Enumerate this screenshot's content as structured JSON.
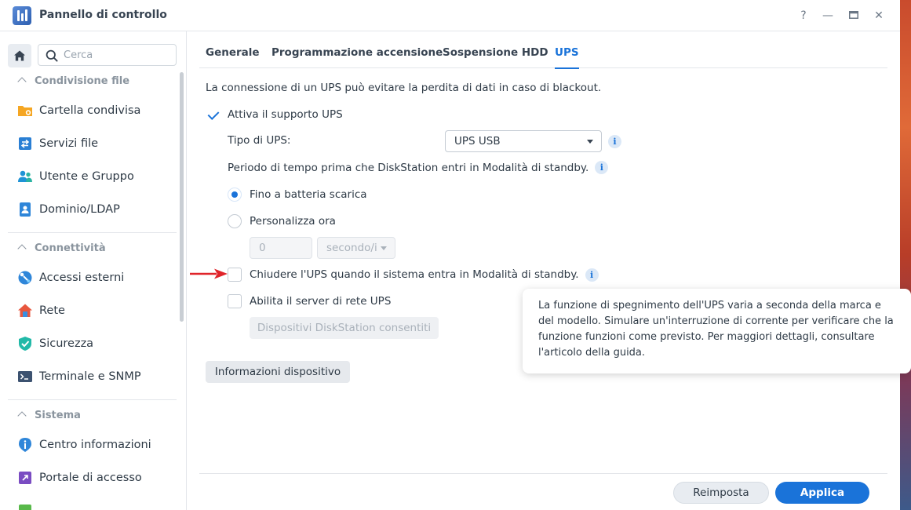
{
  "window": {
    "title": "Pannello di controllo",
    "controls": {
      "help": "?",
      "minimize": "—",
      "maximize": "▭",
      "close": "✕"
    }
  },
  "sidebar": {
    "search_placeholder": "Cerca",
    "sections": [
      {
        "title": "Condivisione file",
        "items": [
          {
            "label": "Cartella condivisa",
            "icon": "folder-share-icon"
          },
          {
            "label": "Servizi file",
            "icon": "file-services-icon"
          },
          {
            "label": "Utente e Gruppo",
            "icon": "users-icon"
          },
          {
            "label": "Dominio/LDAP",
            "icon": "domain-icon"
          }
        ]
      },
      {
        "title": "Connettività",
        "items": [
          {
            "label": "Accessi esterni",
            "icon": "external-access-icon"
          },
          {
            "label": "Rete",
            "icon": "network-house-icon"
          },
          {
            "label": "Sicurezza",
            "icon": "security-shield-icon"
          },
          {
            "label": "Terminale e SNMP",
            "icon": "terminal-icon"
          }
        ]
      },
      {
        "title": "Sistema",
        "items": [
          {
            "label": "Centro informazioni",
            "icon": "info-center-icon"
          },
          {
            "label": "Portale di accesso",
            "icon": "login-portal-icon"
          }
        ]
      }
    ]
  },
  "tabs": [
    {
      "label": "Generale",
      "active": false
    },
    {
      "label": "Programmazione accensione",
      "active": false
    },
    {
      "label": "Sospensione HDD",
      "active": false
    },
    {
      "label": "UPS",
      "active": true
    }
  ],
  "ups": {
    "description": "La connessione di un UPS può evitare la perdita di dati in caso di blackout.",
    "enable_label": "Attiva il supporto UPS",
    "enable_checked": true,
    "type_label": "Tipo di UPS:",
    "type_value": "UPS USB",
    "period_label": "Periodo di tempo prima che DiskStation entri in Modalità di standby.",
    "radio_battery_label": "Fino a batteria scarica",
    "radio_battery_selected": true,
    "radio_custom_label": "Personalizza ora",
    "radio_custom_selected": false,
    "custom_value": "0",
    "custom_unit": "secondo/i",
    "shutdown_label": "Chiudere l'UPS quando il sistema entra in Modalità di standby.",
    "shutdown_checked": false,
    "server_label": "Abilita il server di rete UPS",
    "server_checked": false,
    "allowed_devices_button": "Dispositivi DiskStation consentiti",
    "device_info_button": "Informazioni dispositivo"
  },
  "tooltip": {
    "text": "La funzione di spegnimento dell'UPS varia a seconda della marca e del modello. Simulare un'interruzione di corrente per verificare che la funzione funzioni come previsto. Per maggiori dettagli, consultare l'articolo della guida."
  },
  "footer": {
    "reset_label": "Reimposta",
    "apply_label": "Applica"
  },
  "colors": {
    "accent": "#1a73d9",
    "annotation_arrow": "#e0242a"
  }
}
